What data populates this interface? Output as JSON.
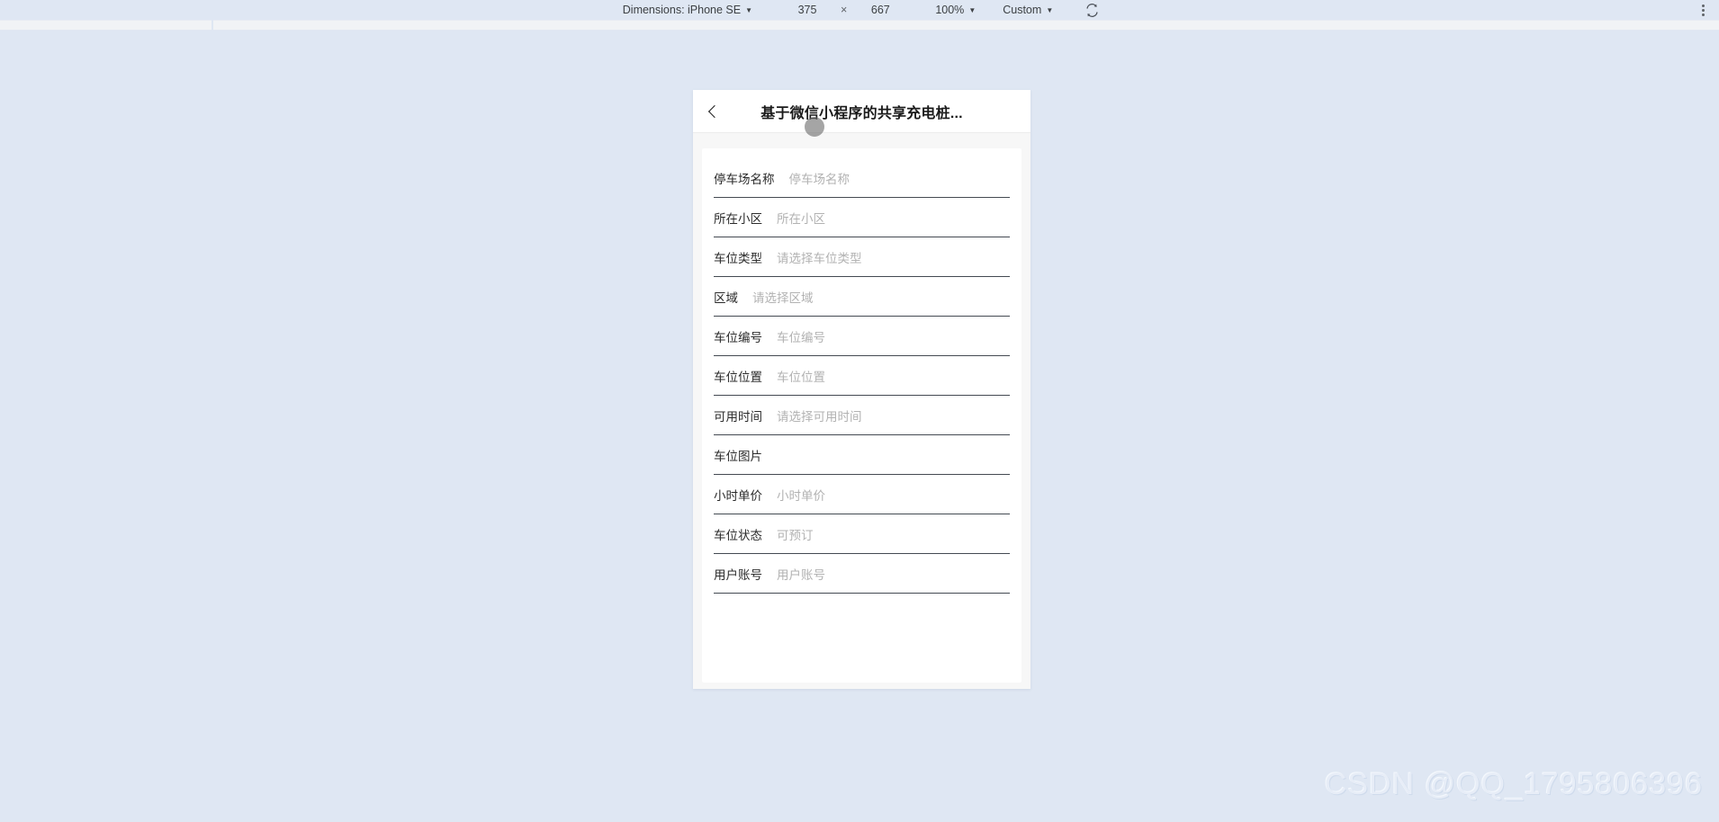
{
  "devtools_toolbar": {
    "dimensions_label": "Dimensions: iPhone SE",
    "width_value": "375",
    "times_symbol": "×",
    "height_value": "667",
    "zoom_label": "100%",
    "throttling_label": "Custom",
    "rotate_icon": "rotate-device-icon",
    "more_icon": "more-vertical-icon",
    "caret": "▼"
  },
  "phone": {
    "nav": {
      "back_icon": "chevron-left-icon",
      "title": "基于微信小程序的共享充电桩..."
    },
    "form": {
      "rows": [
        {
          "label": "停车场名称",
          "value": "停车场名称"
        },
        {
          "label": "所在小区",
          "value": "所在小区"
        },
        {
          "label": "车位类型",
          "value": "请选择车位类型"
        },
        {
          "label": "区域",
          "value": "请选择区域"
        },
        {
          "label": "车位编号",
          "value": "车位编号"
        },
        {
          "label": "车位位置",
          "value": "车位位置"
        },
        {
          "label": "可用时间",
          "value": "请选择可用时间"
        },
        {
          "label": "车位图片",
          "value": ""
        },
        {
          "label": "小时单价",
          "value": "小时单价"
        },
        {
          "label": "车位状态",
          "value": "可预订"
        },
        {
          "label": "用户账号",
          "value": "用户账号"
        }
      ]
    }
  },
  "watermark": {
    "text": "CSDN @QQ_1795806396"
  },
  "colors": {
    "page_background": "#dfe7f3",
    "toolbar_background": "#dfe7f3",
    "phone_background": "#f7f7f7",
    "card_background": "#ffffff",
    "label_text": "#2b2b2b",
    "placeholder_text": "#b2b2b2",
    "divider": "#444a52",
    "watermark": "#e7edf7"
  }
}
